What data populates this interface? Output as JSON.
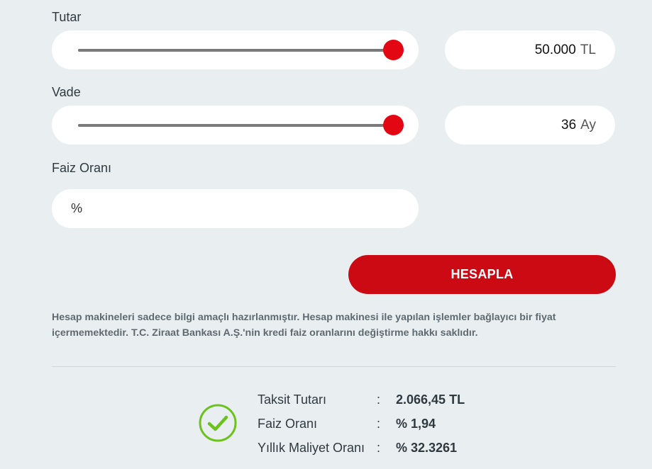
{
  "amount": {
    "label": "Tutar",
    "value": "50.000",
    "unit": "TL",
    "slider_fraction": 1.0
  },
  "term": {
    "label": "Vade",
    "value": "36",
    "unit": "Ay",
    "slider_fraction": 1.0
  },
  "rate": {
    "label": "Faiz Oranı",
    "prefix": "%",
    "value": ""
  },
  "calculate_label": "HESAPLA",
  "disclaimer": "Hesap makineleri sadece bilgi amaçlı hazırlanmıştır. Hesap makinesi ile yapılan işlemler bağlayıcı bir fiyat içermemektedir. T.C. Ziraat Bankası A.Ş.'nin kredi faiz oranlarını değiştirme hakkı saklıdır.",
  "results": [
    {
      "label": "Taksit Tutarı",
      "colon": ":",
      "value": "2.066,45 TL"
    },
    {
      "label": "Faiz Oranı",
      "colon": ":",
      "value": "% 1,94"
    },
    {
      "label": "Yıllık Maliyet Oranı",
      "colon": ":",
      "value": "% 32.3261"
    }
  ],
  "colors": {
    "accent": "#cc0a14",
    "thumb": "#e30613",
    "success": "#6cc21c",
    "background": "#e9eef0"
  },
  "icons": {
    "result_icon": "check-circle-icon"
  }
}
